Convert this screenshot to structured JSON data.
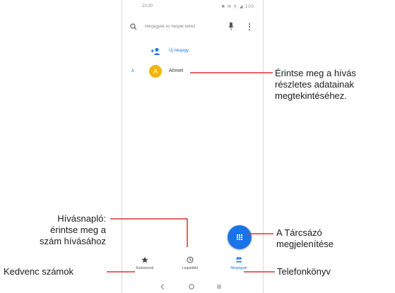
{
  "colors": {
    "accent": "#1a73e8",
    "avatar": "#f4b400",
    "callout_line": "#e03030"
  },
  "status_bar": {
    "time": "10:30",
    "icons_text": "✱ ✉ ⚲ ◢ 100"
  },
  "search": {
    "placeholder": "Névjegyek és helyek keres",
    "icons": [
      "search-icon",
      "mic-icon",
      "more-vert-icon"
    ]
  },
  "new_contact": {
    "label": "Új névjegy",
    "icon": "add-person-icon"
  },
  "contacts": {
    "section_letter": "A",
    "items": [
      {
        "initial": "A",
        "name": "Ahmet"
      }
    ]
  },
  "fab": {
    "icon": "dialpad-icon"
  },
  "bottom_nav": {
    "tabs": [
      {
        "label": "Kedvencek",
        "icon": "star-icon",
        "active": false
      },
      {
        "label": "Legutóbbi",
        "icon": "clock-icon",
        "active": false
      },
      {
        "label": "Névjegyek",
        "icon": "people-icon",
        "active": true
      }
    ]
  },
  "system_nav": {
    "icons": [
      "back-icon",
      "home-icon",
      "recents-icon"
    ]
  },
  "callouts": {
    "contact_details": [
      "Érintse meg a hívás",
      "részletes adatainak",
      "megtekintéséhez."
    ],
    "call_log": [
      "Hívásnapló:",
      "érintse meg a",
      "szám hívásához"
    ],
    "dialer": [
      "A Tárcsázó",
      "megjelenítése"
    ],
    "favorites": "Kedvenc számok",
    "contacts": "Telefonkönyv"
  }
}
